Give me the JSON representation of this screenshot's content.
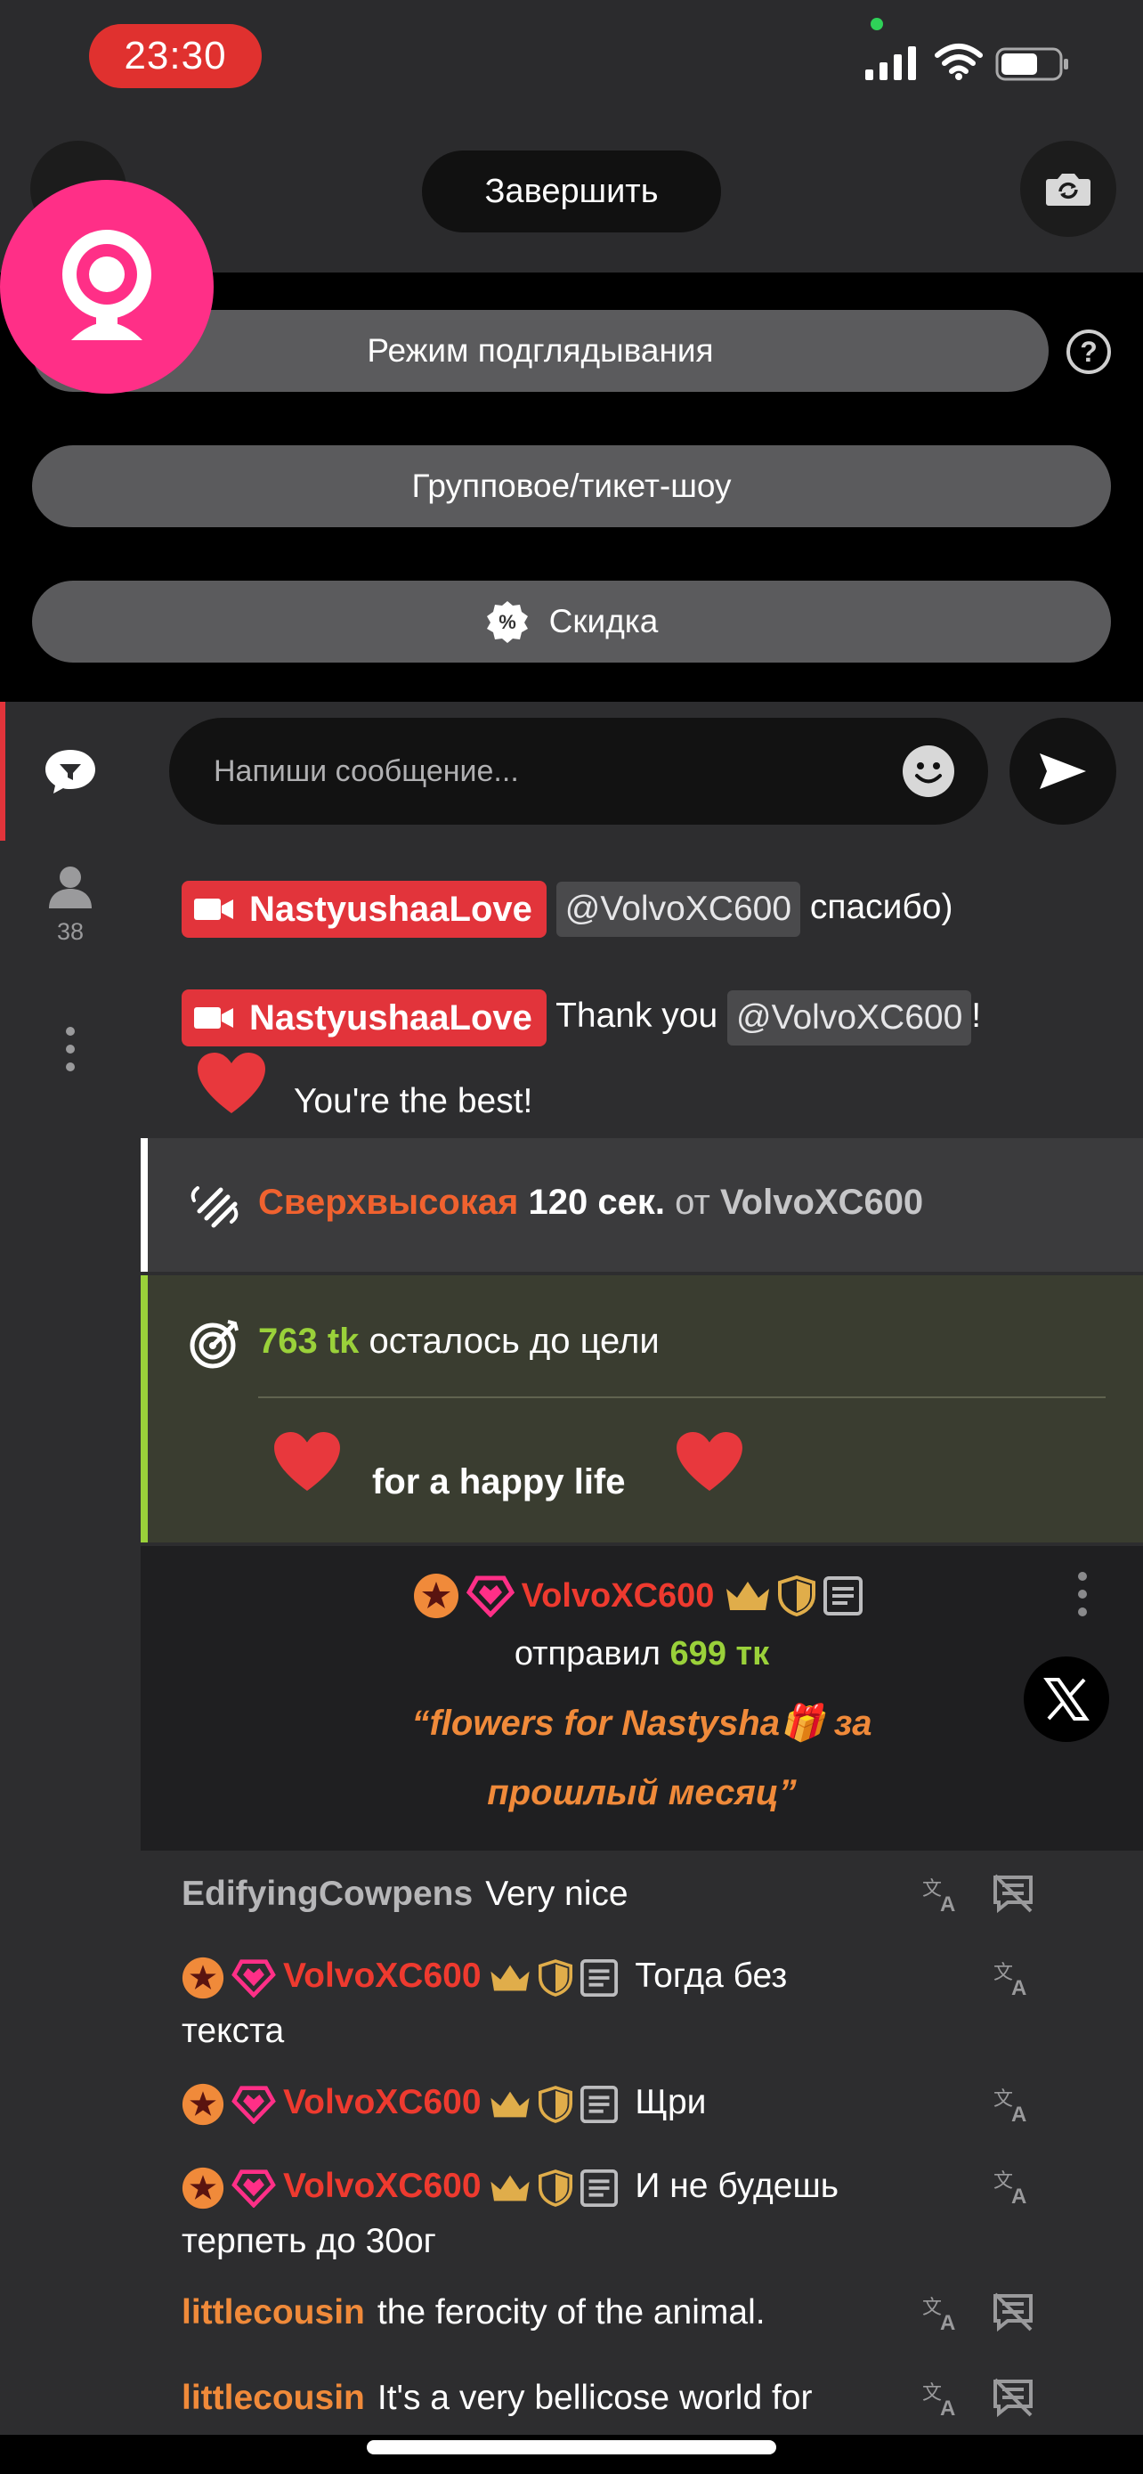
{
  "status_bar": {
    "time": "23:30"
  },
  "top_bar": {
    "end_label": "Завершить"
  },
  "options": {
    "peek_mode": "Режим подглядывания",
    "group_show": "Групповое/тикет-шоу",
    "discount": "Скидка",
    "help": "?"
  },
  "sidebar": {
    "users_count": "38"
  },
  "composer": {
    "placeholder": "Напиши сообщение..."
  },
  "messages": [
    {
      "user": "NastyushaaLove",
      "mention": "@VolvoXC600",
      "text_after": "спасибо)"
    },
    {
      "user": "NastyushaaLove",
      "text_before": "Thank you",
      "mention": "@VolvoXC600",
      "text_after": "!",
      "line2": "You're the best!"
    }
  ],
  "high_event": {
    "level": "Сверхвысокая",
    "duration": "120 сек.",
    "from": "от",
    "user": "VolvoXC600"
  },
  "goal": {
    "amount": "763 tk",
    "text": "осталось до цели",
    "title": "for a happy life"
  },
  "tip": {
    "user": "VolvoXC600",
    "sent": "отправил",
    "amount": "699 тк",
    "note_line1": "“flowers for Nastysha🎁 за",
    "note_line2": "прошлый месяц”"
  },
  "chat": [
    {
      "user": "EdifyingCowpens",
      "text": "Very nice"
    },
    {
      "user": "VolvoXC600",
      "text": "Тогда без",
      "text2": "текста"
    },
    {
      "user": "VolvoXC600",
      "text": "Щри"
    },
    {
      "user": "VolvoXC600",
      "text": "И не будешь",
      "text2": "терпеть до 30ог"
    },
    {
      "user": "littlecousin",
      "text": "the ferocity of the animal."
    },
    {
      "user": "littlecousin",
      "text": "It's a very bellicose world for"
    }
  ],
  "colors": {
    "accent_red": "#e2343b",
    "goal_green": "#9ad13a",
    "webcam_pink": "#ff2f87",
    "tip_orange": "#f08a3a"
  }
}
